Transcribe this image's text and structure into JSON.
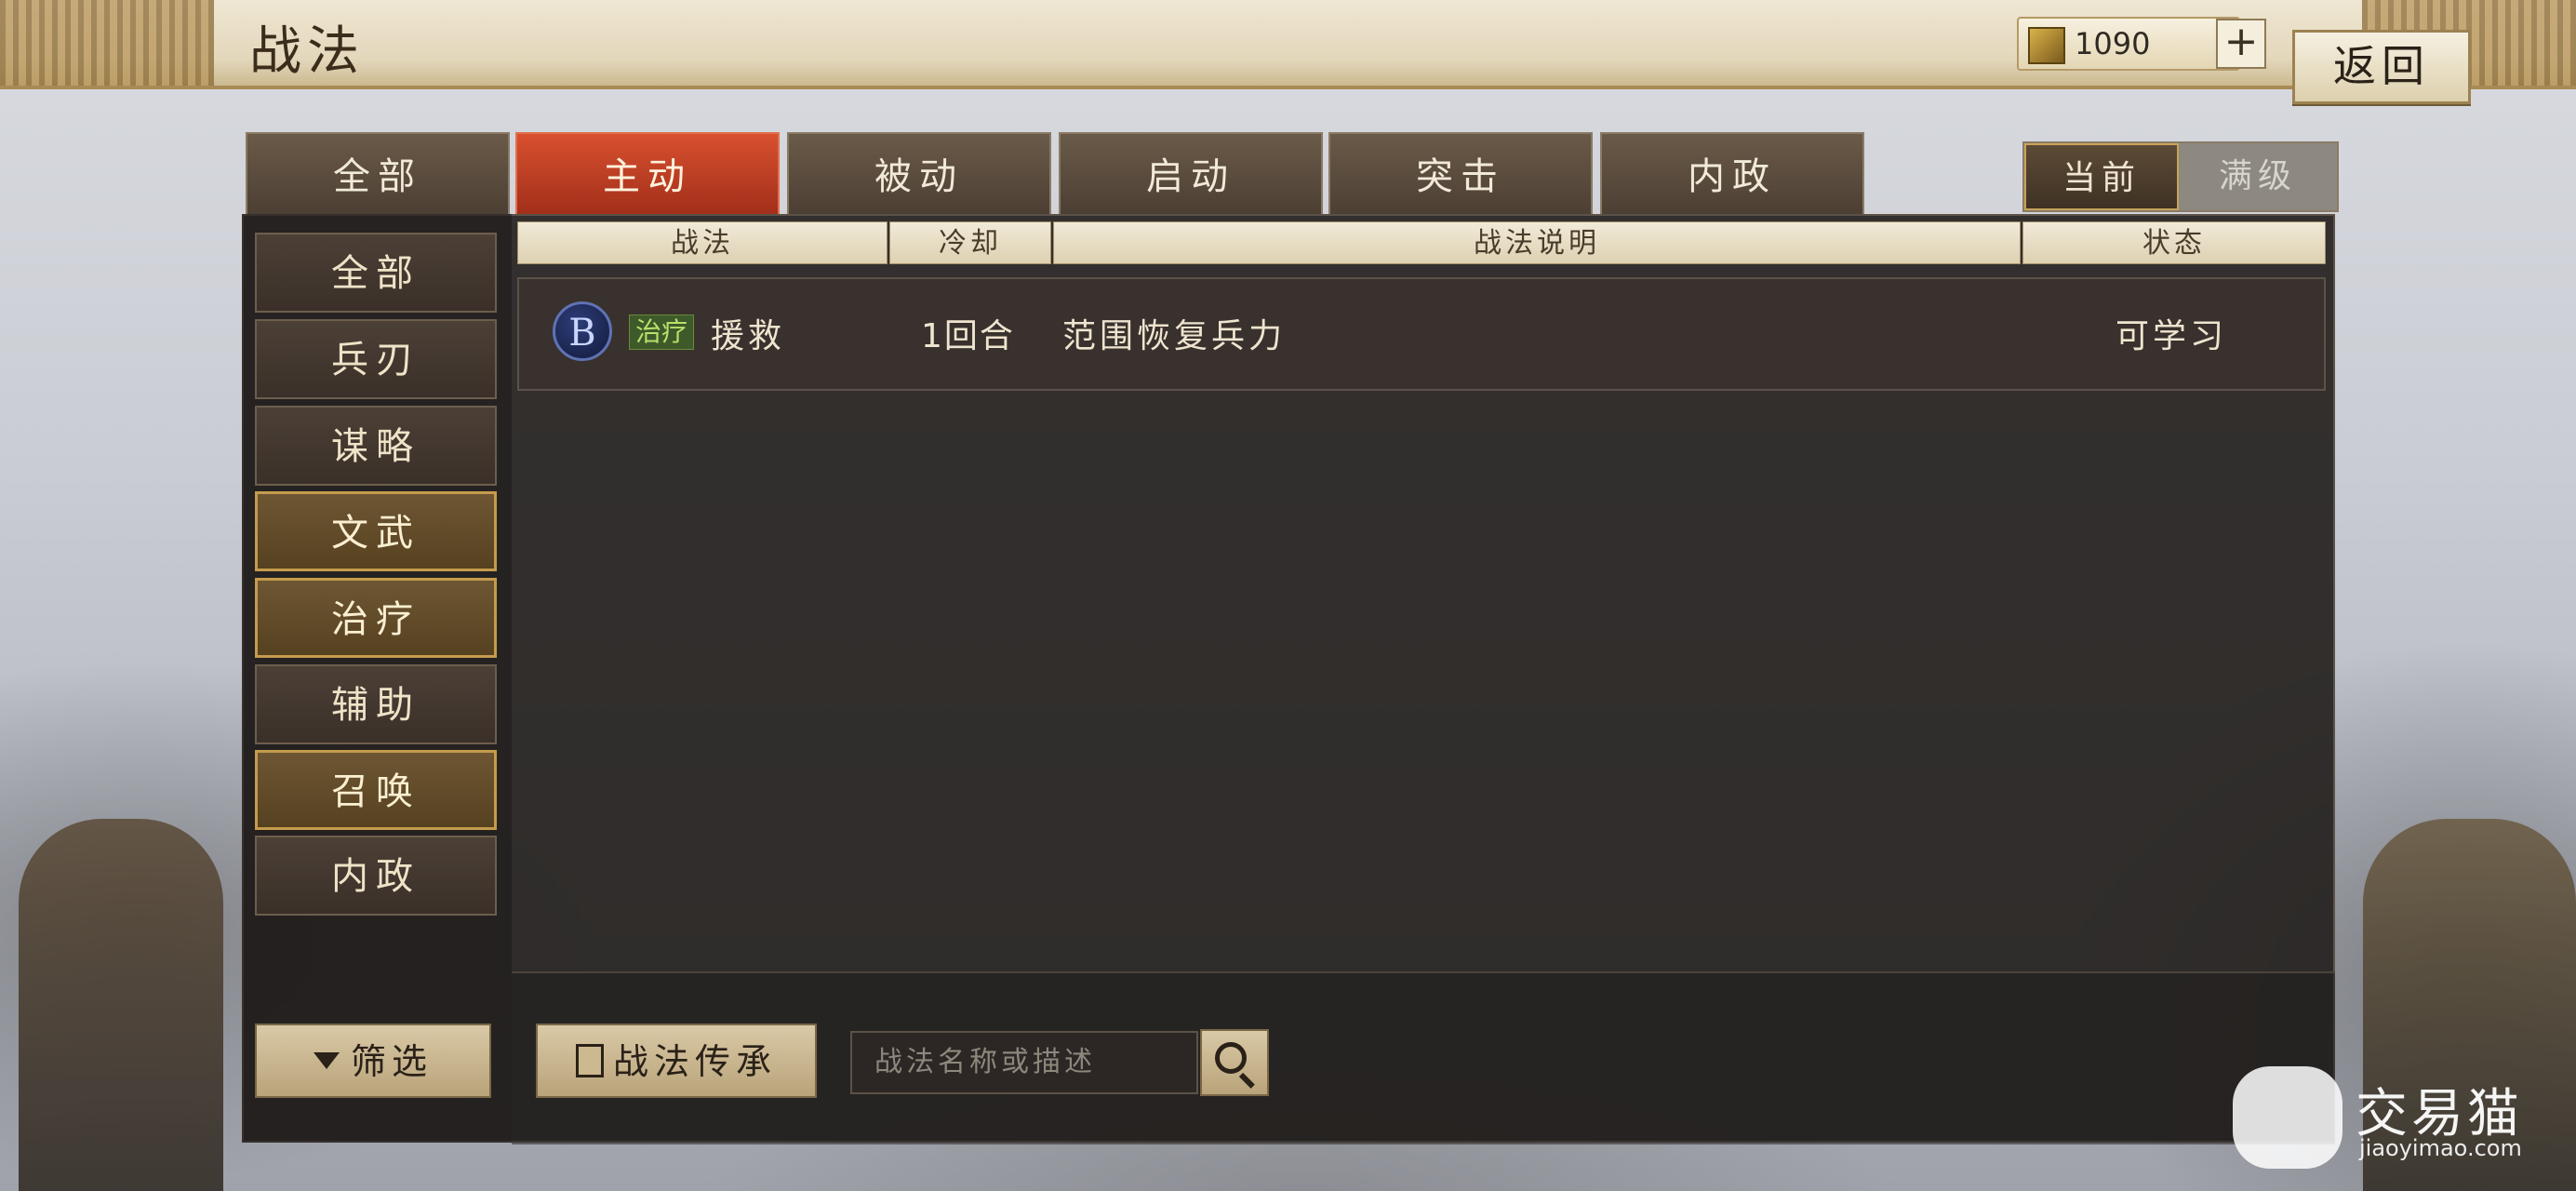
{
  "header": {
    "title": "战法",
    "currency_amount": "1090",
    "plus_label": "+",
    "back_label": "返回"
  },
  "tabs": [
    {
      "label": "全部",
      "active": false
    },
    {
      "label": "主动",
      "active": true
    },
    {
      "label": "被动",
      "active": false
    },
    {
      "label": "启动",
      "active": false
    },
    {
      "label": "突击",
      "active": false
    },
    {
      "label": "内政",
      "active": false
    }
  ],
  "level_toggle": {
    "current_label": "当前",
    "max_label": "满级",
    "selected": "当前"
  },
  "categories": [
    {
      "label": "全部",
      "highlight": false
    },
    {
      "label": "兵刃",
      "highlight": false
    },
    {
      "label": "谋略",
      "highlight": false
    },
    {
      "label": "文武",
      "highlight": true
    },
    {
      "label": "治疗",
      "highlight": true
    },
    {
      "label": "辅助",
      "highlight": false
    },
    {
      "label": "召唤",
      "highlight": true
    },
    {
      "label": "内政",
      "highlight": false
    }
  ],
  "filter_label": "筛选",
  "table": {
    "columns": [
      "战法",
      "冷却",
      "战法说明",
      "状态"
    ],
    "rows": [
      {
        "grade": "B",
        "tag": "治疗",
        "name": "援救",
        "cooldown": "1回合",
        "description": "范围恢复兵力",
        "status": "可学习"
      }
    ]
  },
  "bottom": {
    "inherit_label": "战法传承",
    "search_placeholder": "战法名称或描述"
  },
  "watermark": {
    "name": "交易猫",
    "url": "jiaoyimao.com"
  },
  "colors": {
    "active_tab": "#c0432a",
    "panel_bg": "#26221f",
    "gold_border": "#c59b4c",
    "tag_green": "#b8e06a"
  },
  "icons": {
    "currency": "jade-token-icon",
    "filter": "funnel-icon",
    "inherit": "book-icon",
    "search": "magnifier-icon"
  }
}
